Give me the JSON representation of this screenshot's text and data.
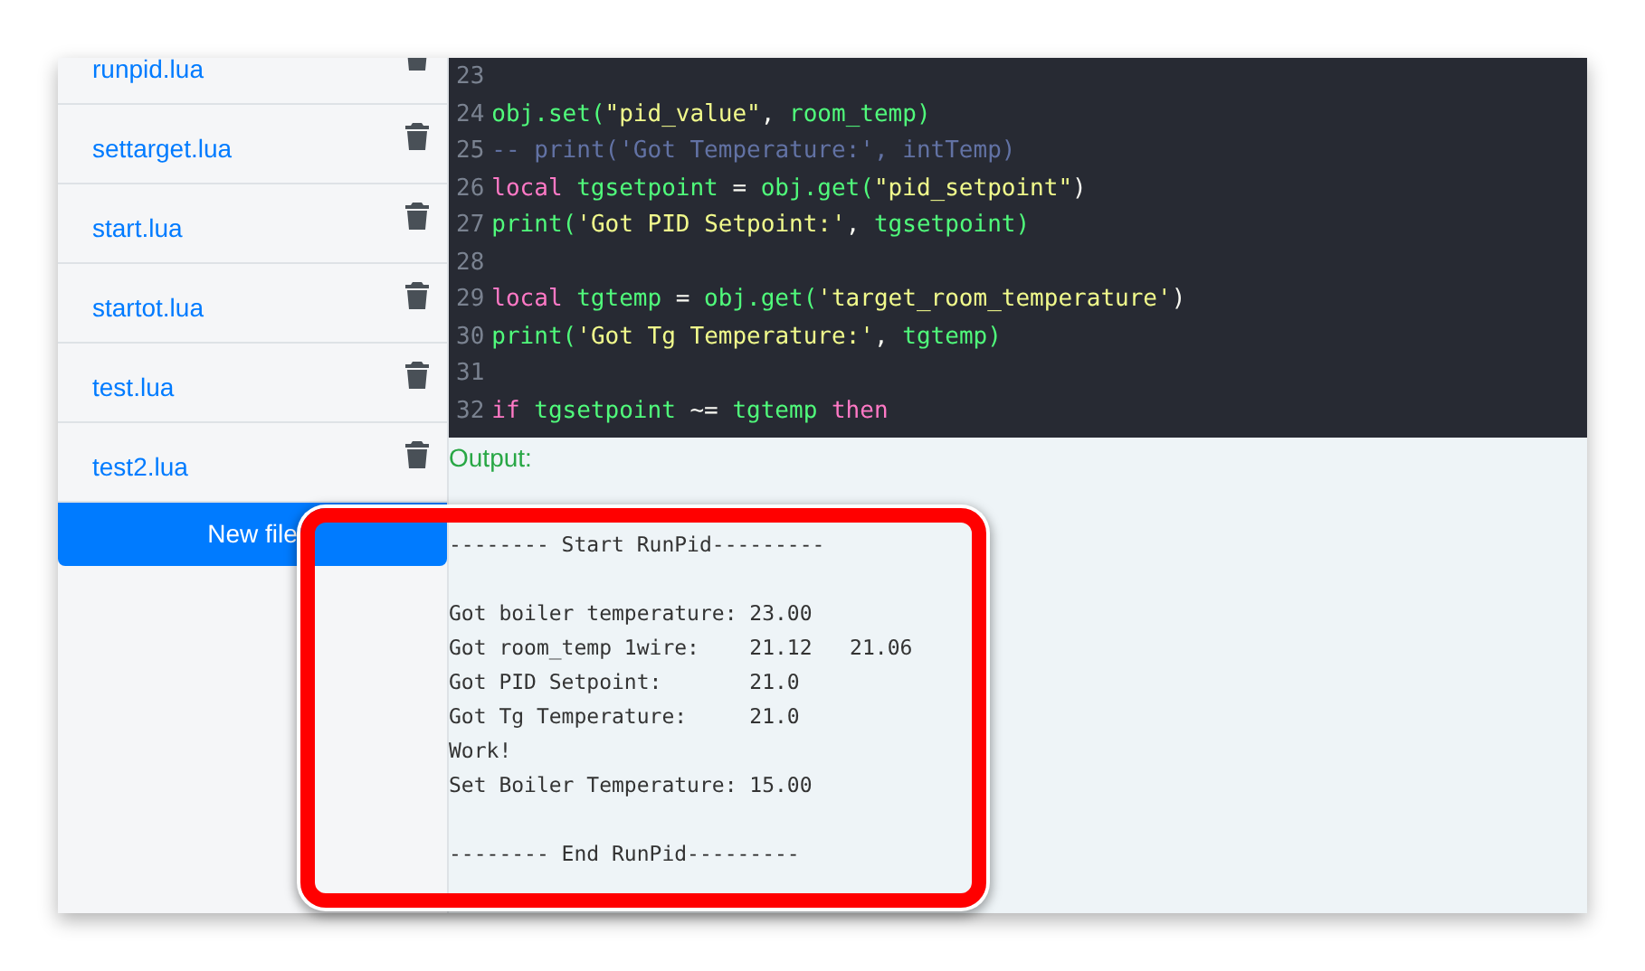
{
  "sidebar": {
    "files": [
      {
        "name": "runpid.lua"
      },
      {
        "name": "settarget.lua"
      },
      {
        "name": "start.lua"
      },
      {
        "name": "startot.lua"
      },
      {
        "name": "test.lua"
      },
      {
        "name": "test2.lua"
      }
    ],
    "new_file_button": "New file"
  },
  "editor": {
    "lines": [
      {
        "number": "23"
      },
      {
        "number": "24",
        "tokens": [
          {
            "kind": "code",
            "text": "obj.set("
          },
          {
            "kind": "string",
            "text": "\"pid_value\""
          },
          {
            "kind": "punct",
            "text": ","
          },
          {
            "kind": "code",
            "text": "room_temp)",
            "gap": true
          }
        ]
      },
      {
        "number": "25",
        "tokens": [
          {
            "kind": "comment",
            "text": "-- print('Got Temperature:', intTemp)"
          }
        ]
      },
      {
        "number": "26",
        "tokens": [
          {
            "kind": "keyword",
            "text": "local"
          },
          {
            "kind": "code",
            "text": "tgsetpoint",
            "gap": true
          },
          {
            "kind": "punct",
            "text": "=",
            "gap": true
          },
          {
            "kind": "code",
            "text": "obj.get(",
            "gap": true
          },
          {
            "kind": "string",
            "text": "\"pid_setpoint\""
          },
          {
            "kind": "punct",
            "text": ")"
          }
        ]
      },
      {
        "number": "27",
        "tokens": [
          {
            "kind": "code",
            "text": "print("
          },
          {
            "kind": "string",
            "text": "'Got PID Setpoint:'"
          },
          {
            "kind": "punct",
            "text": ","
          },
          {
            "kind": "code",
            "text": "tgsetpoint)",
            "gap": true
          }
        ]
      },
      {
        "number": "28"
      },
      {
        "number": "29",
        "tokens": [
          {
            "kind": "keyword",
            "text": "local"
          },
          {
            "kind": "code",
            "text": "tgtemp",
            "gap": true
          },
          {
            "kind": "punct",
            "text": "=",
            "gap": true
          },
          {
            "kind": "code",
            "text": "obj.get(",
            "gap": true
          },
          {
            "kind": "string",
            "text": "'target_room_temperature'"
          },
          {
            "kind": "punct",
            "text": ")"
          }
        ]
      },
      {
        "number": "30",
        "tokens": [
          {
            "kind": "code",
            "text": "print("
          },
          {
            "kind": "string",
            "text": "'Got Tg Temperature:'"
          },
          {
            "kind": "punct",
            "text": ","
          },
          {
            "kind": "code",
            "text": "tgtemp)",
            "gap": true
          }
        ]
      },
      {
        "number": "31"
      },
      {
        "number": "32",
        "tokens": [
          {
            "kind": "keyword",
            "text": "if"
          },
          {
            "kind": "code",
            "text": "tgsetpoint",
            "gap": true
          },
          {
            "kind": "punct",
            "text": "~=",
            "gap": true
          },
          {
            "kind": "code",
            "text": "tgtemp",
            "gap": true
          },
          {
            "kind": "keyword",
            "text": "then",
            "gap": true
          }
        ]
      }
    ]
  },
  "output": {
    "label": "Output:",
    "lines": [
      {
        "kind": "blank"
      },
      {
        "kind": "text",
        "text": "-------- Start RunPid---------"
      },
      {
        "kind": "blank"
      },
      {
        "kind": "text",
        "text": "Got boiler temperature: 23.00"
      },
      {
        "kind": "text",
        "text": "Got room_temp 1wire:    21.12   21.06"
      },
      {
        "kind": "text",
        "text": "Got PID Setpoint:       21.0"
      },
      {
        "kind": "text",
        "text": "Got Tg Temperature:     21.0"
      },
      {
        "kind": "text",
        "text": "Work!"
      },
      {
        "kind": "text",
        "text": "Set Boiler Temperature: 15.00"
      },
      {
        "kind": "blank"
      },
      {
        "kind": "text",
        "text": "-------- End RunPid---------"
      }
    ]
  }
}
